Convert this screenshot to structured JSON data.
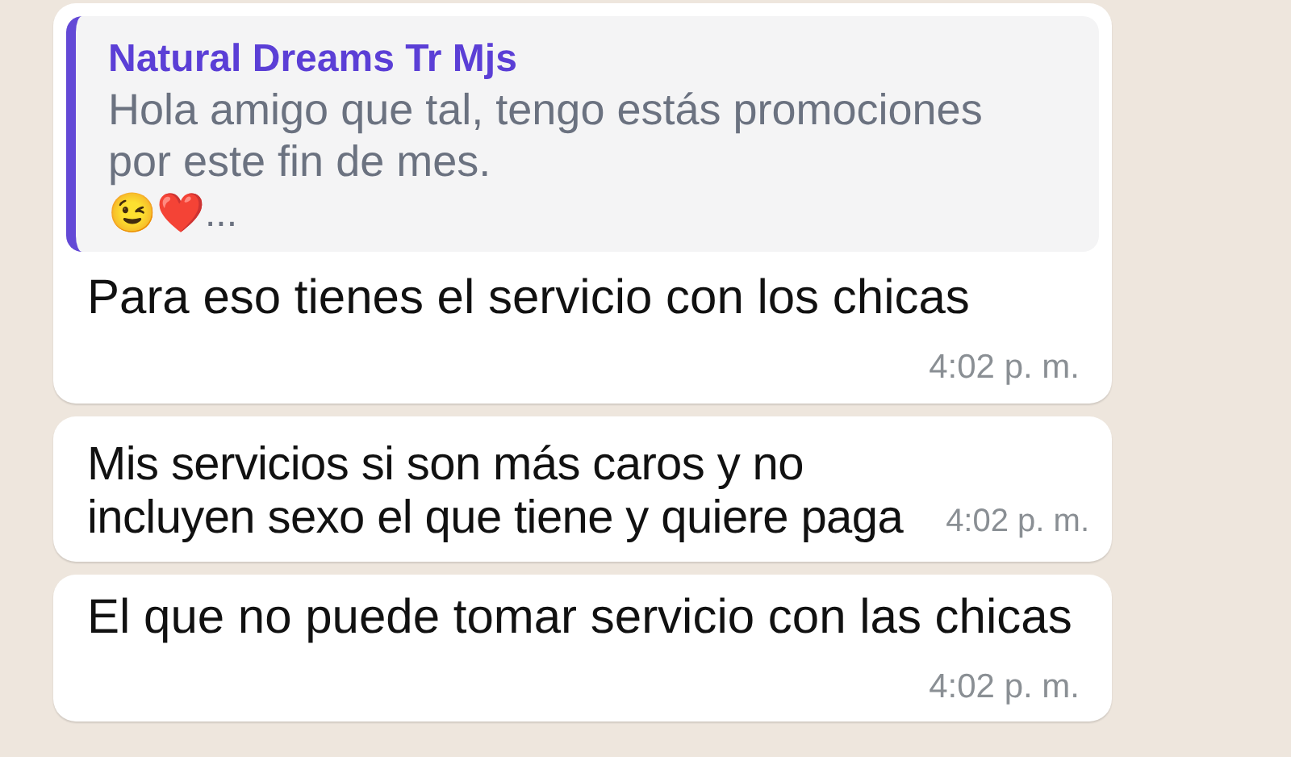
{
  "messages": [
    {
      "quote": {
        "author": "Natural Dreams Tr Mjs",
        "text": "Hola amigo que tal, tengo estás promociones por este fin de mes.",
        "extra": "😉❤️..."
      },
      "text": "Para eso tienes el servicio con los chicas",
      "time": "4:02 p. m."
    },
    {
      "text": "Mis servicios si son más caros y no incluyen sexo el que tiene y quiere paga",
      "time": "4:02 p. m."
    },
    {
      "text": "El que no puede tomar servicio con las chicas",
      "time": "4:02 p. m."
    }
  ]
}
